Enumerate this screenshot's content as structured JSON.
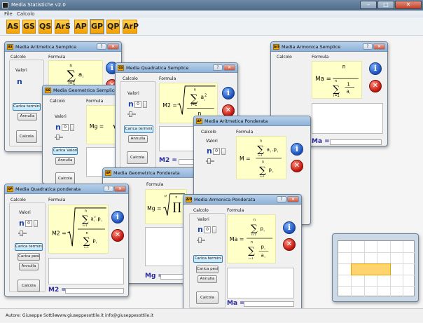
{
  "app": {
    "title": "Media Statistiche v2.0",
    "menu": [
      "File",
      "Calcolo"
    ],
    "controls": {
      "minimize": "–",
      "maximize": "□",
      "close": "✕"
    }
  },
  "toolbar": {
    "buttons": [
      "AS",
      "GS",
      "QS",
      "ArS",
      "AP",
      "GP",
      "QP",
      "ArP"
    ],
    "active": "GP"
  },
  "labels": {
    "calcolo": "Calcolo",
    "formula": "Formula",
    "valori": "Valori",
    "n": "n",
    "n_value": "0",
    "carica_termini": "Carica termini",
    "carica_valori": "Carica Valori",
    "carica_pesi": "Carica pesi",
    "annulla": "Annulla",
    "calcola": "Calcola",
    "info_glyph": "i",
    "clear_glyph": "✕",
    "eq": "="
  },
  "windows": {
    "w1": {
      "title": "Media Aritmetica Semplice",
      "icon": "AS",
      "formula_symbol": "Ma",
      "formula_lhs": "Ma =",
      "buttons": [
        "?",
        "✕"
      ]
    },
    "w2": {
      "title": "Media Armonica Semplice",
      "icon": "ArS",
      "formula_symbol": "Ma",
      "formula_lhs": "Ma =",
      "result": "Ma =",
      "buttons": [
        "?",
        "✕"
      ]
    },
    "w3": {
      "title": "Media Quadratica Semplice",
      "icon": "QS",
      "formula_lhs": "M2 =",
      "result": "M2 =",
      "buttons": [
        "?",
        "✕"
      ]
    },
    "w4": {
      "title": "Media Geometrica Semplice",
      "icon": "GS",
      "formula_lhs": "Mg =",
      "buttons": [
        "?",
        "✕"
      ]
    },
    "w5": {
      "title": "Media Aritmetica Ponderata",
      "icon": "AP",
      "formula_lhs": "M =",
      "buttons": [
        "?",
        "✕"
      ]
    },
    "w6": {
      "title": "Media Geometrica Ponderata",
      "icon": "GP",
      "formula_lhs": "Mg =",
      "result": "Mg =",
      "buttons": [
        "?",
        "✕"
      ]
    },
    "w7": {
      "title": "Media Quadratica ponderata",
      "icon": "QP",
      "formula_lhs": "M2 =",
      "result": "M2 =",
      "buttons": [
        "?",
        "✕"
      ]
    },
    "w8": {
      "title": "Media Armonica Ponderata",
      "icon": "ArP",
      "formula_lhs": "Ma =",
      "result": "Ma =",
      "buttons": [
        "?",
        "✕"
      ]
    }
  },
  "status": {
    "author": "Autore: Giuseppe Sottile",
    "site": "www.giuseppesottile.it",
    "email": "info@giuseppesottile.it"
  },
  "colors": {
    "toolbar_button": "#f4a000",
    "formula_bg": "#ffffc8",
    "title_gradient": "#8fb2d8",
    "info_icon": "#1b4fb8",
    "clear_icon": "#c0140a"
  }
}
